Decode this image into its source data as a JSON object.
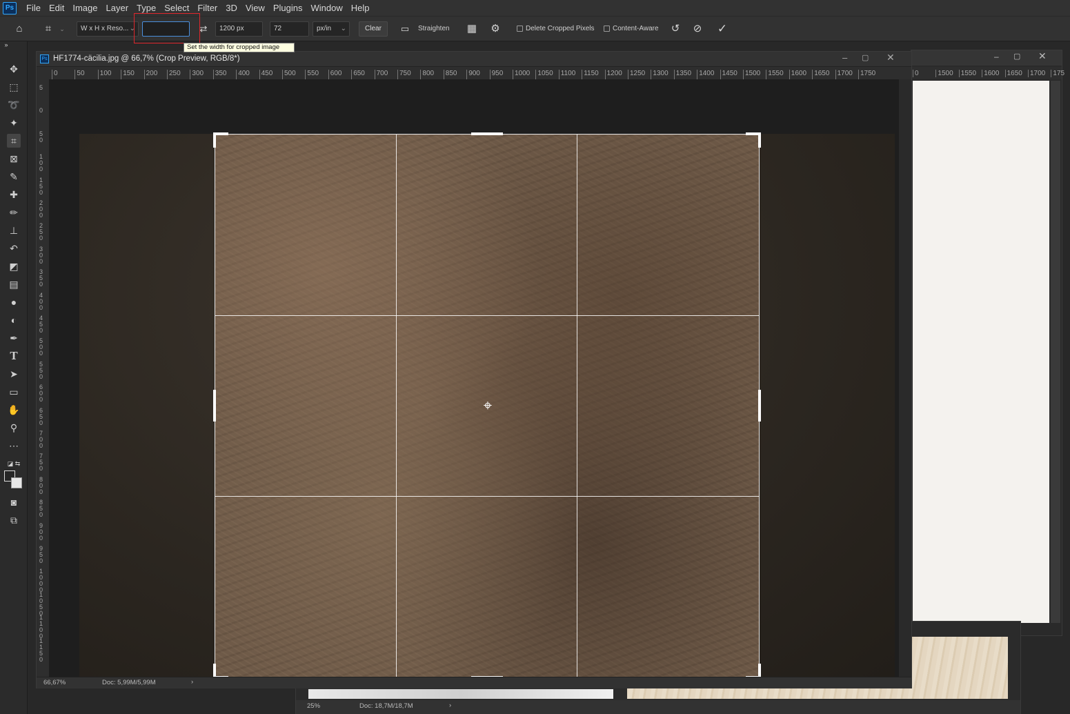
{
  "menu": {
    "logo": "Ps",
    "items": [
      "File",
      "Edit",
      "Image",
      "Layer",
      "Type",
      "Select",
      "Filter",
      "3D",
      "View",
      "Plugins",
      "Window",
      "Help"
    ]
  },
  "options": {
    "preset": "W x H x Reso...",
    "width_value": "",
    "height_value": "1200 px",
    "resolution_value": "72",
    "resolution_unit": "px/in",
    "clear_label": "Clear",
    "straighten_label": "Straighten",
    "delete_cropped_label": "Delete Cropped Pixels",
    "content_aware_label": "Content-Aware",
    "tooltip": "Set the width for cropped image",
    "highlight_color": "#e0262c"
  },
  "document": {
    "title": "HF1774-cäcilia.jpg @ 66,7% (Crop Preview, RGB/8*)",
    "zoom": "66,67%",
    "doc_size": "Doc: 5,99M/5,99M",
    "h_ruler": [
      "0",
      "50",
      "100",
      "150",
      "200",
      "250",
      "300",
      "350",
      "400",
      "450",
      "500",
      "550",
      "600",
      "650",
      "700",
      "750",
      "800",
      "850",
      "900",
      "950",
      "1000",
      "1050",
      "1100",
      "1150",
      "1200",
      "1250",
      "1300",
      "1350",
      "1400",
      "1450",
      "1500",
      "1550",
      "1600",
      "1650",
      "1700",
      "1750"
    ],
    "v_ruler": [
      "5",
      "0",
      "50",
      "100",
      "150",
      "200",
      "250",
      "300",
      "350",
      "400",
      "450",
      "500",
      "550",
      "600",
      "650",
      "700",
      "750",
      "800",
      "850",
      "900",
      "950",
      "1000",
      "1050",
      "1100",
      "1150"
    ]
  },
  "back_window": {
    "h_ruler": [
      "0",
      "1500",
      "1550",
      "1600",
      "1650",
      "1700",
      "175"
    ]
  },
  "bottom_window": {
    "zoom": "25%",
    "doc_size": "Doc: 18,7M/18,7M"
  }
}
